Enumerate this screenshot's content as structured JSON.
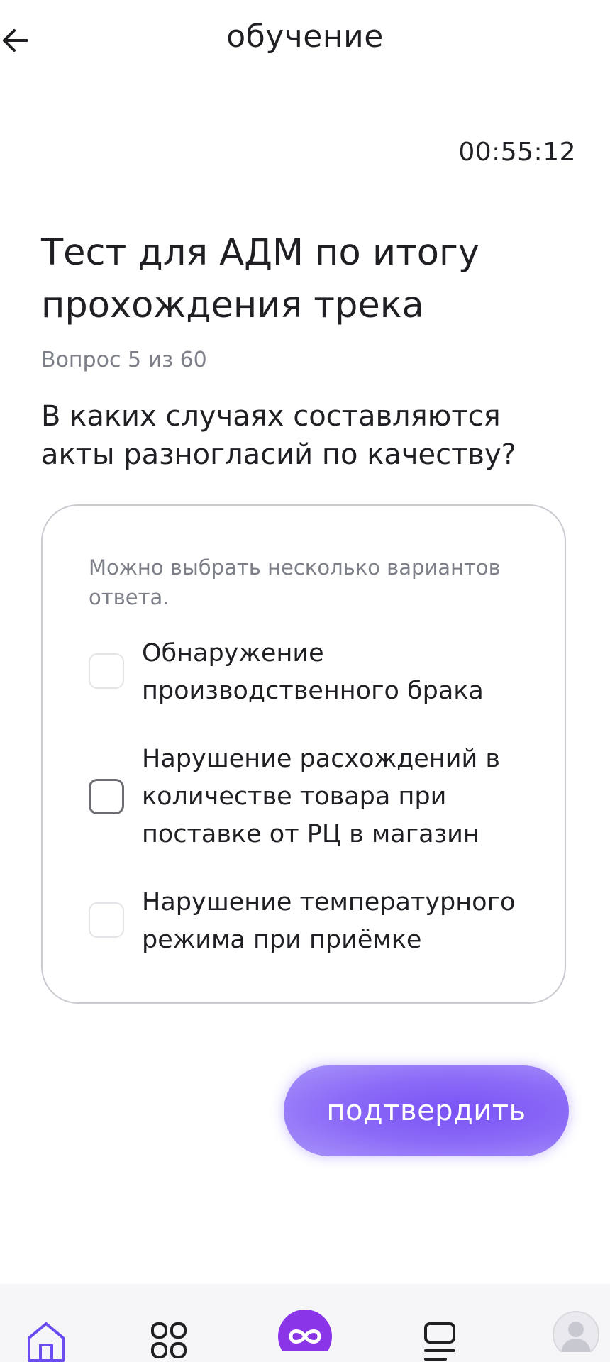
{
  "header": {
    "title": "обучение",
    "back_icon": "arrow-left-icon"
  },
  "timer": {
    "value": "00:55:12"
  },
  "test": {
    "title": "Тест для АДМ по итогу прохождения трека",
    "progress": "Вопрос 5 из 60",
    "current_question": 5,
    "total_questions": 60
  },
  "question": {
    "text": "В каких случаях составляются акты разногласий по качеству?",
    "hint": "Можно выбрать несколько вариантов ответа.",
    "options": [
      {
        "label": "Обнаружение производственного брака",
        "checked": false
      },
      {
        "label": "Нарушение расхождений в количестве товара при поставке от РЦ в магазин",
        "checked": false
      },
      {
        "label": "Нарушение температурного режима при приёмке",
        "checked": false
      }
    ]
  },
  "actions": {
    "confirm_label": "подтвердить"
  },
  "bottom_nav": {
    "items": [
      {
        "icon": "home-icon",
        "active": true
      },
      {
        "icon": "grid-icon",
        "active": false
      },
      {
        "icon": "infinity-icon",
        "active": false
      },
      {
        "icon": "list-icon",
        "active": false
      },
      {
        "icon": "avatar-icon",
        "active": false
      }
    ]
  },
  "colors": {
    "accent": "#7a52f5",
    "accent_light": "#a894fa",
    "text": "#1f1f24",
    "muted": "#7d8089",
    "border": "#c9cbd1"
  }
}
